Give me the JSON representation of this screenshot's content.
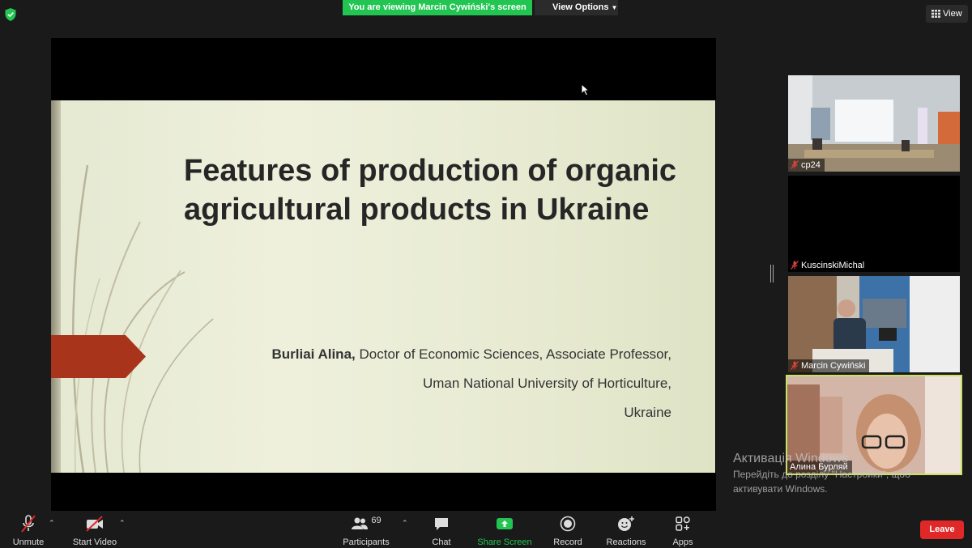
{
  "banner": {
    "viewing_text": "You are viewing Marcin Cywiński's screen",
    "view_options_label": "View Options",
    "view_label": "View"
  },
  "slide": {
    "title": "Features of production of organic agricultural products in Ukraine",
    "author_name": "Burliai Alina,",
    "author_role": "Doctor of Economic Sciences, Associate Professor,",
    "university": "Uman National University of Horticulture,",
    "country": "Ukraine"
  },
  "participants": [
    {
      "name": "cp24",
      "muted": true
    },
    {
      "name": "KuscinskiMichal",
      "muted": true
    },
    {
      "name": "Marcin Cywiński",
      "muted": true
    },
    {
      "name": "Алина Бурляй",
      "muted": false,
      "active_speaker": true
    }
  ],
  "watermark": {
    "line1": "Активація Windows",
    "line2": "Перейдіть до розділу \"Настройки\", щоб",
    "line3": "активувати Windows."
  },
  "toolbar": {
    "unmute_label": "Unmute",
    "start_video_label": "Start Video",
    "participants_label": "Participants",
    "participants_count": "69",
    "chat_label": "Chat",
    "share_screen_label": "Share Screen",
    "record_label": "Record",
    "reactions_label": "Reactions",
    "apps_label": "Apps",
    "leave_label": "Leave"
  },
  "colors": {
    "share_green": "#23c552",
    "leave_red": "#e02828",
    "active_border": "#c9e265",
    "slide_arrow": "#a8341c"
  }
}
